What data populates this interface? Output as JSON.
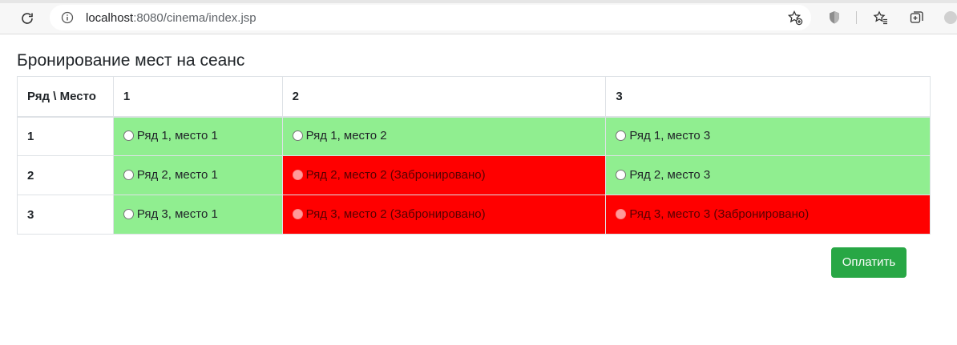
{
  "browser": {
    "url_host": "localhost",
    "url_rest": ":8080/cinema/index.jsp",
    "icons": [
      "reload-icon",
      "info-icon",
      "add-favorite-icon",
      "shield-icon",
      "favorites-icon",
      "collections-icon",
      "profile-icon"
    ]
  },
  "page": {
    "title": "Бронирование мест на сеанс"
  },
  "table": {
    "corner_header": "Ряд \\ Место",
    "columns": [
      "1",
      "2",
      "3"
    ],
    "rows": [
      {
        "label": "1",
        "seats": [
          {
            "text": "Ряд 1, место 1",
            "status": "free"
          },
          {
            "text": "Ряд 1, место 2",
            "status": "free"
          },
          {
            "text": "Ряд 1, место 3",
            "status": "free"
          }
        ]
      },
      {
        "label": "2",
        "seats": [
          {
            "text": "Ряд 2, место 1",
            "status": "free"
          },
          {
            "text": "Ряд 2, место 2 (Забронировано)",
            "status": "booked"
          },
          {
            "text": "Ряд 2, место 3",
            "status": "free"
          }
        ]
      },
      {
        "label": "3",
        "seats": [
          {
            "text": "Ряд 3, место 1",
            "status": "free"
          },
          {
            "text": "Ряд 3, место 2 (Забронировано)",
            "status": "booked"
          },
          {
            "text": "Ряд 3, место 3 (Забронировано)",
            "status": "booked"
          }
        ]
      }
    ]
  },
  "actions": {
    "pay_label": "Оплатить"
  },
  "colors": {
    "free": "#90ee90",
    "booked": "#ff0000",
    "pay_button": "#28a745"
  }
}
